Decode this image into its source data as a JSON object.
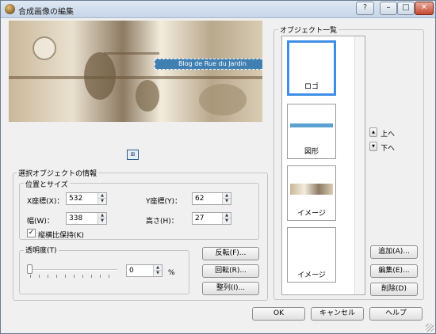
{
  "window": {
    "title": "合成画像の編集",
    "icon": "app-icon",
    "controls": {
      "help": "?",
      "minimize": "–",
      "maximize": "□",
      "close": "✕"
    }
  },
  "preview": {
    "overlay_text": "Blog de Rue du Jardin",
    "move_handle_icon": "move-handle-icon"
  },
  "selected_object": {
    "legend": "選択オブジェクトの情報",
    "position_size": {
      "legend": "位置とサイズ",
      "x_label": "X座標(X)：",
      "x_value": "532",
      "y_label": "Y座標(Y)：",
      "y_value": "62",
      "width_label": "幅(W)：",
      "width_value": "338",
      "height_label": "高さ(H)：",
      "height_value": "27",
      "keep_ratio_label": "縦横比保持(K)",
      "keep_ratio_checked": true
    },
    "transparency": {
      "legend": "透明度(T)",
      "value": "0",
      "unit": "%",
      "slider_level": 0
    },
    "buttons": {
      "flip": "反転(F)...",
      "rotate": "回転(R)...",
      "align": "整列(I)..."
    }
  },
  "object_list": {
    "legend": "オブジェクト一覧",
    "items": [
      {
        "label": "ロゴ",
        "selected": true
      },
      {
        "label": "図形",
        "selected": false
      },
      {
        "label": "イメージ",
        "selected": false
      },
      {
        "label": "イメージ",
        "selected": false
      }
    ],
    "order": {
      "up": "上へ",
      "down": "下へ"
    },
    "buttons": {
      "add": "追加(A)...",
      "edit": "編集(E)...",
      "delete": "削除(D)"
    }
  },
  "footer": {
    "ok": "OK",
    "cancel": "キャンセル",
    "help": "ヘルプ"
  },
  "colors": {
    "accent": "#3d8ee6",
    "shape_bar": "#5aa0d0"
  }
}
